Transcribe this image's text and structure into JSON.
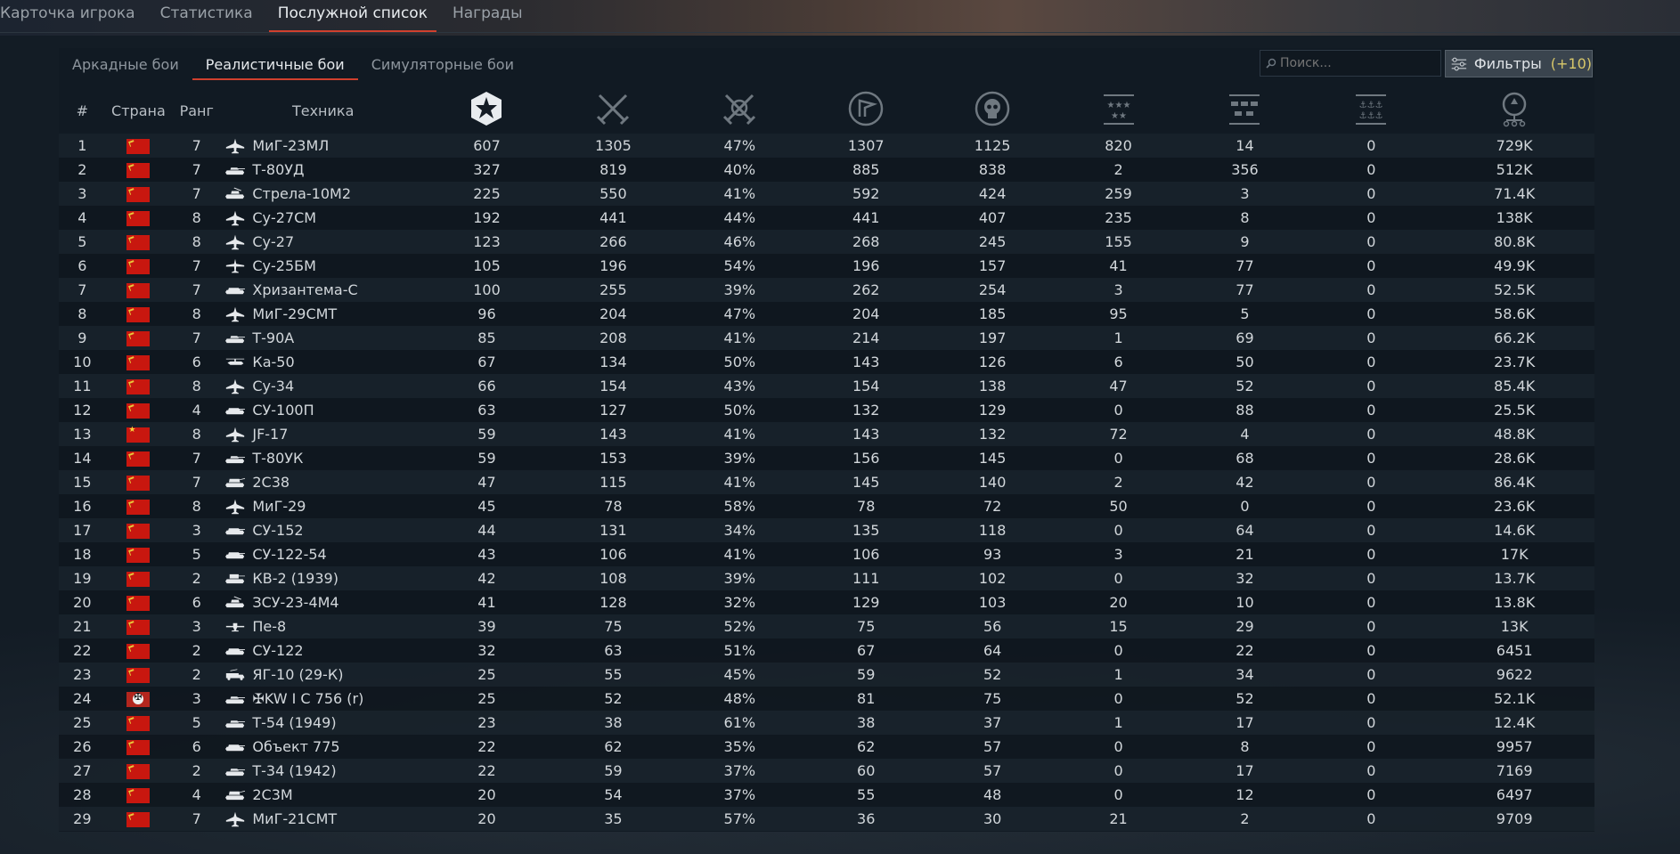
{
  "top_tabs": [
    {
      "label": "Карточка игрока",
      "active": false
    },
    {
      "label": "Статистика",
      "active": false
    },
    {
      "label": "Послужной список",
      "active": true
    },
    {
      "label": "Награды",
      "active": false
    }
  ],
  "mode_tabs": [
    {
      "label": "Аркадные бои",
      "active": false
    },
    {
      "label": "Реалистичные бои",
      "active": true
    },
    {
      "label": "Симуляторные бои",
      "active": false
    }
  ],
  "search": {
    "placeholder": "Поиск..."
  },
  "filters": {
    "label": "Фильтры",
    "count": "(+10)"
  },
  "columns": {
    "num": "#",
    "country": "Страна",
    "rank": "Ранг",
    "vehicle": "Техника",
    "icons": [
      "score-icon",
      "battles-icon",
      "victories-icon",
      "respawns-icon",
      "deaths-icon",
      "air-kills-icon",
      "ground-kills-icon",
      "naval-kills-icon",
      "research-icon"
    ]
  },
  "colors": {
    "accent": "#d0402e",
    "score": "#e5c45a"
  },
  "rows": [
    {
      "n": "1",
      "flag": "ussr",
      "rank": "7",
      "type": "jet",
      "name": "МиГ-23МЛ",
      "score": "607",
      "c1": "1305",
      "c2": "47%",
      "c3": "1307",
      "c4": "1125",
      "c5": "820",
      "c6": "14",
      "c7": "0",
      "c8": "729K"
    },
    {
      "n": "2",
      "flag": "ussr",
      "rank": "7",
      "type": "tank",
      "name": "Т-80УД",
      "score": "327",
      "c1": "819",
      "c2": "40%",
      "c3": "885",
      "c4": "838",
      "c5": "2",
      "c6": "356",
      "c7": "0",
      "c8": "512K"
    },
    {
      "n": "3",
      "flag": "ussr",
      "rank": "7",
      "type": "spaa",
      "name": "Стрела-10М2",
      "score": "225",
      "c1": "550",
      "c2": "41%",
      "c3": "592",
      "c4": "424",
      "c5": "259",
      "c6": "3",
      "c7": "0",
      "c8": "71.4K"
    },
    {
      "n": "4",
      "flag": "ussr",
      "rank": "8",
      "type": "jet",
      "name": "Су-27СМ",
      "score": "192",
      "c1": "441",
      "c2": "44%",
      "c3": "441",
      "c4": "407",
      "c5": "235",
      "c6": "8",
      "c7": "0",
      "c8": "138K"
    },
    {
      "n": "5",
      "flag": "ussr",
      "rank": "8",
      "type": "jet",
      "name": "Су-27",
      "score": "123",
      "c1": "266",
      "c2": "46%",
      "c3": "268",
      "c4": "245",
      "c5": "155",
      "c6": "9",
      "c7": "0",
      "c8": "80.8K"
    },
    {
      "n": "6",
      "flag": "ussr",
      "rank": "7",
      "type": "plane",
      "name": "Су-25БМ",
      "score": "105",
      "c1": "196",
      "c2": "54%",
      "c3": "196",
      "c4": "157",
      "c5": "41",
      "c6": "77",
      "c7": "0",
      "c8": "49.9K"
    },
    {
      "n": "7",
      "flag": "ussr",
      "rank": "7",
      "type": "tankdest",
      "name": "Хризантема-С",
      "score": "100",
      "c1": "255",
      "c2": "39%",
      "c3": "262",
      "c4": "254",
      "c5": "3",
      "c6": "77",
      "c7": "0",
      "c8": "52.5K"
    },
    {
      "n": "8",
      "flag": "ussr",
      "rank": "8",
      "type": "jet",
      "name": "МиГ-29СМТ",
      "score": "96",
      "c1": "204",
      "c2": "47%",
      "c3": "204",
      "c4": "185",
      "c5": "95",
      "c6": "5",
      "c7": "0",
      "c8": "58.6K"
    },
    {
      "n": "9",
      "flag": "ussr",
      "rank": "7",
      "type": "tank",
      "name": "Т-90А",
      "score": "85",
      "c1": "208",
      "c2": "41%",
      "c3": "214",
      "c4": "197",
      "c5": "1",
      "c6": "69",
      "c7": "0",
      "c8": "66.2K"
    },
    {
      "n": "10",
      "flag": "ussr",
      "rank": "6",
      "type": "heli",
      "name": "Ка-50",
      "score": "67",
      "c1": "134",
      "c2": "50%",
      "c3": "143",
      "c4": "126",
      "c5": "6",
      "c6": "50",
      "c7": "0",
      "c8": "23.7K"
    },
    {
      "n": "11",
      "flag": "ussr",
      "rank": "8",
      "type": "jet",
      "name": "Су-34",
      "score": "66",
      "c1": "154",
      "c2": "43%",
      "c3": "154",
      "c4": "138",
      "c5": "47",
      "c6": "52",
      "c7": "0",
      "c8": "85.4K"
    },
    {
      "n": "12",
      "flag": "ussr",
      "rank": "4",
      "type": "tankdest",
      "name": "СУ-100П",
      "score": "63",
      "c1": "127",
      "c2": "50%",
      "c3": "132",
      "c4": "129",
      "c5": "0",
      "c6": "88",
      "c7": "0",
      "c8": "25.5K"
    },
    {
      "n": "13",
      "flag": "china",
      "rank": "8",
      "type": "jet",
      "name": "JF-17",
      "score": "59",
      "c1": "143",
      "c2": "41%",
      "c3": "143",
      "c4": "132",
      "c5": "72",
      "c6": "4",
      "c7": "0",
      "c8": "48.8K"
    },
    {
      "n": "14",
      "flag": "ussr",
      "rank": "7",
      "type": "tank",
      "name": "Т-80УК",
      "score": "59",
      "c1": "153",
      "c2": "39%",
      "c3": "156",
      "c4": "145",
      "c5": "0",
      "c6": "68",
      "c7": "0",
      "c8": "28.6K"
    },
    {
      "n": "15",
      "flag": "ussr",
      "rank": "7",
      "type": "spg",
      "name": "2С38",
      "score": "47",
      "c1": "115",
      "c2": "41%",
      "c3": "145",
      "c4": "140",
      "c5": "2",
      "c6": "42",
      "c7": "0",
      "c8": "86.4K"
    },
    {
      "n": "16",
      "flag": "ussr",
      "rank": "8",
      "type": "jet",
      "name": "МиГ-29",
      "score": "45",
      "c1": "78",
      "c2": "58%",
      "c3": "78",
      "c4": "72",
      "c5": "50",
      "c6": "0",
      "c7": "0",
      "c8": "23.6K"
    },
    {
      "n": "17",
      "flag": "ussr",
      "rank": "3",
      "type": "tankdest",
      "name": "СУ-152",
      "score": "44",
      "c1": "131",
      "c2": "34%",
      "c3": "135",
      "c4": "118",
      "c5": "0",
      "c6": "64",
      "c7": "0",
      "c8": "14.6K"
    },
    {
      "n": "18",
      "flag": "ussr",
      "rank": "5",
      "type": "tankdest",
      "name": "СУ-122-54",
      "score": "43",
      "c1": "106",
      "c2": "41%",
      "c3": "106",
      "c4": "93",
      "c5": "3",
      "c6": "21",
      "c7": "0",
      "c8": "17K"
    },
    {
      "n": "19",
      "flag": "ussr",
      "rank": "2",
      "type": "heavytank",
      "name": "КВ-2 (1939)",
      "score": "42",
      "c1": "108",
      "c2": "39%",
      "c3": "111",
      "c4": "102",
      "c5": "0",
      "c6": "32",
      "c7": "0",
      "c8": "13.7K"
    },
    {
      "n": "20",
      "flag": "ussr",
      "rank": "6",
      "type": "spaa",
      "name": "ЗСУ-23-4М4",
      "score": "41",
      "c1": "128",
      "c2": "32%",
      "c3": "129",
      "c4": "103",
      "c5": "20",
      "c6": "10",
      "c7": "0",
      "c8": "13.8K"
    },
    {
      "n": "21",
      "flag": "ussr",
      "rank": "3",
      "type": "bomber",
      "name": "Пе-8",
      "score": "39",
      "c1": "75",
      "c2": "52%",
      "c3": "75",
      "c4": "56",
      "c5": "15",
      "c6": "29",
      "c7": "0",
      "c8": "13K"
    },
    {
      "n": "22",
      "flag": "ussr",
      "rank": "2",
      "type": "tankdest",
      "name": "СУ-122",
      "score": "32",
      "c1": "63",
      "c2": "51%",
      "c3": "67",
      "c4": "64",
      "c5": "0",
      "c6": "22",
      "c7": "0",
      "c8": "6451"
    },
    {
      "n": "23",
      "flag": "ussr",
      "rank": "2",
      "type": "truck",
      "name": "ЯГ-10 (29-К)",
      "score": "25",
      "c1": "55",
      "c2": "45%",
      "c3": "59",
      "c4": "52",
      "c5": "1",
      "c6": "34",
      "c7": "0",
      "c8": "9622"
    },
    {
      "n": "24",
      "flag": "germany",
      "rank": "3",
      "type": "tank",
      "name": "✠KW I C 756 (r)",
      "score": "25",
      "c1": "52",
      "c2": "48%",
      "c3": "81",
      "c4": "75",
      "c5": "0",
      "c6": "52",
      "c7": "0",
      "c8": "52.1K"
    },
    {
      "n": "25",
      "flag": "ussr",
      "rank": "5",
      "type": "tank",
      "name": "Т-54 (1949)",
      "score": "23",
      "c1": "38",
      "c2": "61%",
      "c3": "38",
      "c4": "37",
      "c5": "1",
      "c6": "17",
      "c7": "0",
      "c8": "12.4K"
    },
    {
      "n": "26",
      "flag": "ussr",
      "rank": "6",
      "type": "tankdest",
      "name": "Объект 775",
      "score": "22",
      "c1": "62",
      "c2": "35%",
      "c3": "62",
      "c4": "57",
      "c5": "0",
      "c6": "8",
      "c7": "0",
      "c8": "9957"
    },
    {
      "n": "27",
      "flag": "ussr",
      "rank": "2",
      "type": "tank",
      "name": "Т-34 (1942)",
      "score": "22",
      "c1": "59",
      "c2": "37%",
      "c3": "60",
      "c4": "57",
      "c5": "0",
      "c6": "17",
      "c7": "0",
      "c8": "7169"
    },
    {
      "n": "28",
      "flag": "ussr",
      "rank": "4",
      "type": "spg",
      "name": "2С3М",
      "score": "20",
      "c1": "54",
      "c2": "37%",
      "c3": "55",
      "c4": "48",
      "c5": "0",
      "c6": "12",
      "c7": "0",
      "c8": "6497"
    },
    {
      "n": "29",
      "flag": "ussr",
      "rank": "7",
      "type": "jet",
      "name": "МиГ-21СМТ",
      "score": "20",
      "c1": "35",
      "c2": "57%",
      "c3": "36",
      "c4": "30",
      "c5": "21",
      "c6": "2",
      "c7": "0",
      "c8": "9709"
    }
  ]
}
